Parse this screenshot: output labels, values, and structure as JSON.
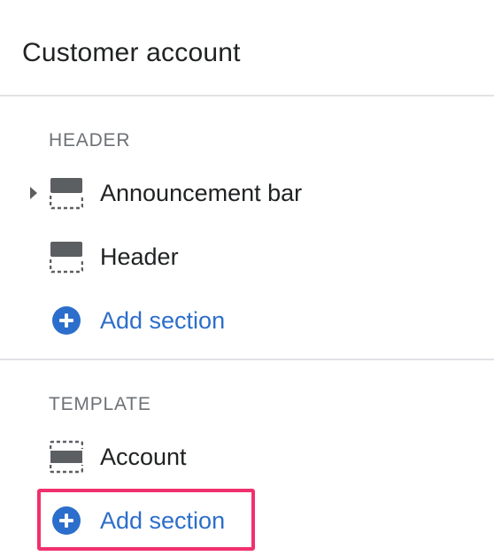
{
  "panel": {
    "title": "Customer account"
  },
  "groups": [
    {
      "heading": "HEADER",
      "items": [
        {
          "label": "Announcement bar",
          "icon": "header-section-icon",
          "expandable": true
        },
        {
          "label": "Header",
          "icon": "header-section-icon",
          "expandable": false
        }
      ],
      "add_label": "Add section"
    },
    {
      "heading": "TEMPLATE",
      "items": [
        {
          "label": "Account",
          "icon": "template-section-icon",
          "expandable": false
        }
      ],
      "add_label": "Add section"
    }
  ],
  "colors": {
    "text": "#202223",
    "muted": "#6d7175",
    "accent": "#2c6ecb",
    "icon": "#5c5f62",
    "divider": "#e1e3e5",
    "highlight": "#f1306e"
  }
}
